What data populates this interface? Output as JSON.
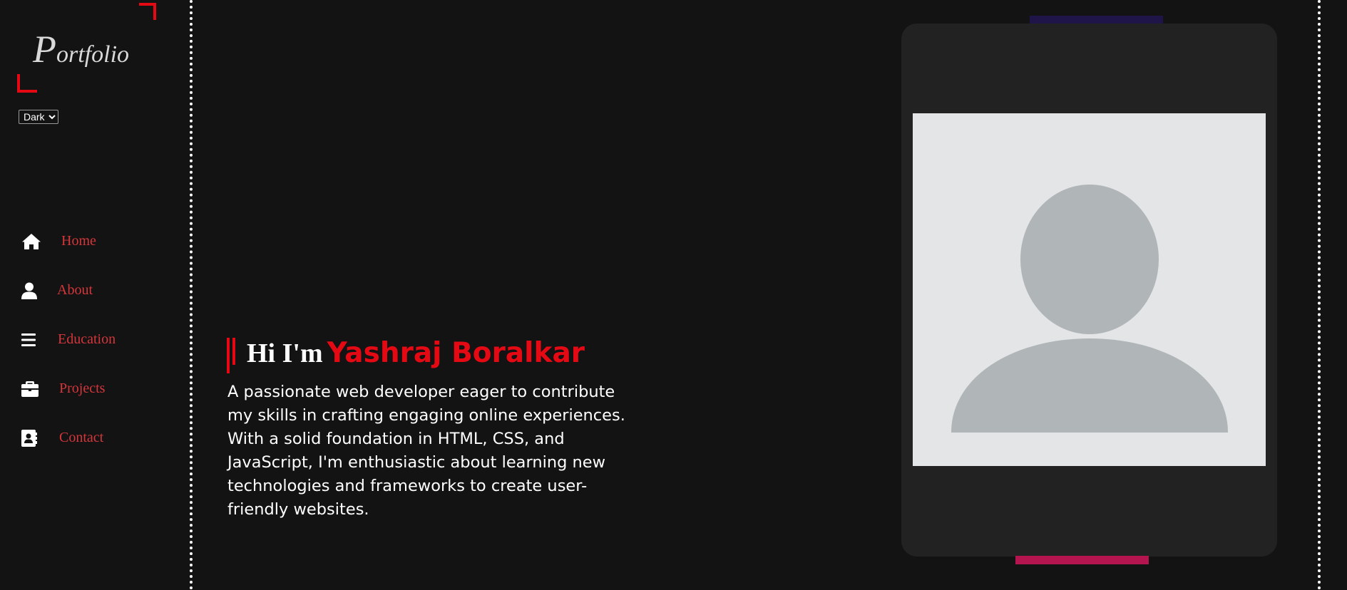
{
  "logo": {
    "initial": "P",
    "rest": "ortfolio"
  },
  "theme": {
    "selected": "Dark",
    "options": [
      "Dark"
    ]
  },
  "nav": {
    "items": [
      {
        "label": "Home",
        "icon": "home-icon"
      },
      {
        "label": "About",
        "icon": "user-icon"
      },
      {
        "label": "Education",
        "icon": "bars-icon"
      },
      {
        "label": "Projects",
        "icon": "briefcase-icon"
      },
      {
        "label": "Contact",
        "icon": "contact-book-icon"
      }
    ]
  },
  "hero": {
    "greeting": "Hi I'm",
    "name": "Yashraj Boralkar",
    "intro": "A passionate web developer eager to contribute my skills in crafting engaging online experiences. With a solid foundation in HTML, CSS, and JavaScript, I'm enthusiastic about learning new technologies and frameworks to create user-friendly websites."
  },
  "colors": {
    "background": "#131313",
    "card": "#222222",
    "accent_red": "#e50914",
    "nav_text": "#d4363b",
    "accent_top_bar": "#1f1548",
    "accent_bottom_bar": "#b5154e",
    "avatar_bg": "#e4e5e7",
    "avatar_figure": "#b0b5b8"
  }
}
